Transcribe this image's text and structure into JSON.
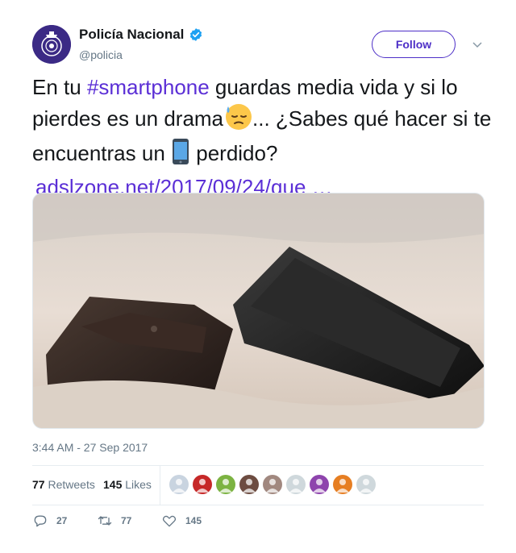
{
  "account": {
    "name": "Policía Nacional",
    "handle": "@policia",
    "follow_label": "Follow"
  },
  "tweet": {
    "part1": "En tu ",
    "hashtag": "#smartphone",
    "part2": " guardas media vida y si lo pierdes es un drama",
    "part3": "... ¿Sabes qué hacer si te encuentras un ",
    "part4": " perdido?",
    "link": "adslzone.net/2017/09/24/que …",
    "emoji_1": "downcast-face-with-sweat",
    "emoji_2": "mobile-phone"
  },
  "timestamp": "3:44 AM - 27 Sep 2017",
  "stats": {
    "retweets_count": "77",
    "retweets_label": "Retweets",
    "likes_count": "145",
    "likes_label": "Likes"
  },
  "likers": [
    "#c9d4e0",
    "#c62828",
    "#7cb342",
    "#6d4c41",
    "#a1887f",
    "#cfd8dc",
    "#8e44ad",
    "#e67e22",
    "#cfd8dc"
  ],
  "actions": {
    "replies": "27",
    "retweets": "77",
    "likes": "145"
  },
  "colors": {
    "accent": "#5b2fd6",
    "follow_border": "#4d2fc7",
    "muted": "#657786",
    "verified": "#1da1f2"
  }
}
